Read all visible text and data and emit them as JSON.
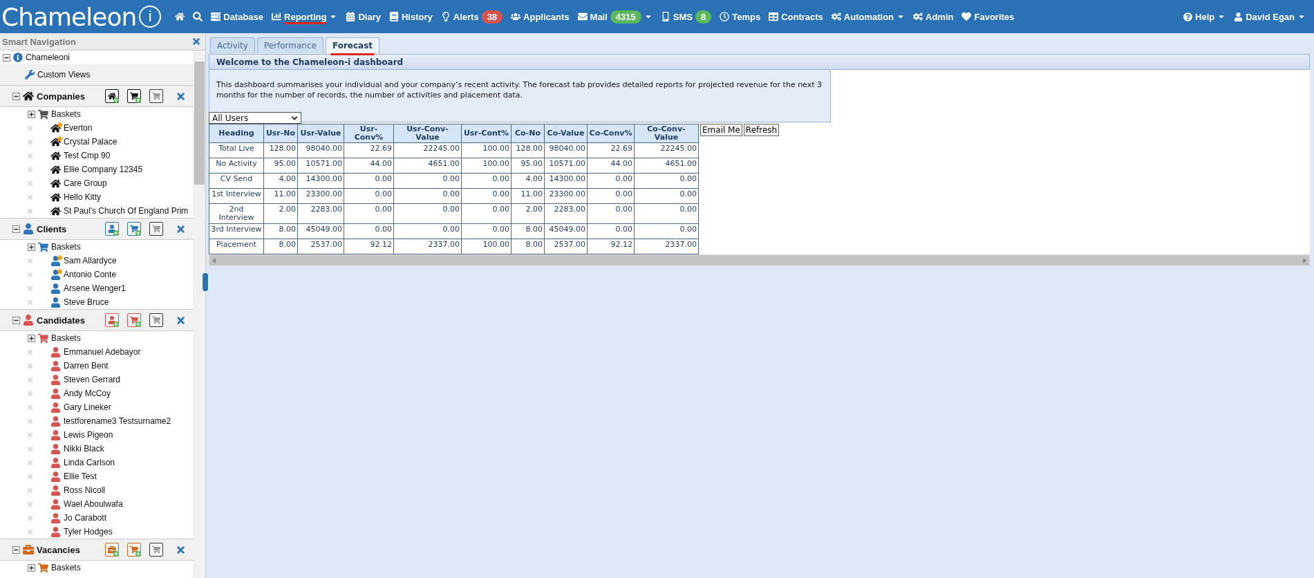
{
  "logo": {
    "text": "Chameleon",
    "mark": "i"
  },
  "nav": [
    {
      "kind": "home",
      "selected": false,
      "dropdown": false
    },
    {
      "kind": "search",
      "selected": false,
      "dropdown": false
    },
    {
      "kind": "database",
      "label": "Database",
      "selected": false,
      "dropdown": false
    },
    {
      "kind": "reporting",
      "label": "Reporting",
      "selected": true,
      "dropdown": true
    },
    {
      "kind": "diary",
      "label": "Diary",
      "selected": false,
      "dropdown": false
    },
    {
      "kind": "history",
      "label": "History",
      "selected": false,
      "dropdown": false
    },
    {
      "kind": "alerts",
      "label": "Alerts",
      "selected": false,
      "dropdown": false,
      "badge": "38",
      "color": "#d9534f"
    },
    {
      "kind": "applicants",
      "label": "Applicants",
      "selected": false,
      "dropdown": false
    },
    {
      "kind": "mail",
      "label": "Mail",
      "selected": false,
      "dropdown": true,
      "badge": "4315",
      "color": "#5cb85c"
    },
    {
      "kind": "sms",
      "label": "SMS",
      "selected": false,
      "dropdown": false,
      "badge": "8",
      "color": "#5cb85c"
    },
    {
      "kind": "temps",
      "label": "Temps",
      "selected": false,
      "dropdown": false
    },
    {
      "kind": "contracts",
      "label": "Contracts",
      "selected": false,
      "dropdown": false
    },
    {
      "kind": "automation",
      "label": "Automation",
      "selected": false,
      "dropdown": true
    },
    {
      "kind": "admin",
      "label": "Admin",
      "selected": false,
      "dropdown": false
    },
    {
      "kind": "favorites",
      "label": "Favorites",
      "selected": false,
      "dropdown": false
    }
  ],
  "nav_right": [
    {
      "kind": "help",
      "label": "Help",
      "dropdown": true
    },
    {
      "kind": "user",
      "label": "David Egan",
      "dropdown": true
    }
  ],
  "sidebar": {
    "title": "Smart Navigation",
    "root": {
      "label": "Chameleoni",
      "expanded": true
    },
    "custom_views": "Custom Views",
    "sections": [
      {
        "kind": "company",
        "title": "Companies",
        "color": "#111111",
        "expanded": true,
        "baskets": {
          "label": "Baskets",
          "expanded": false
        },
        "items": [
          {
            "label": "Everton",
            "starred": true
          },
          {
            "label": "Crystal Palace",
            "starred": true
          },
          {
            "label": "Test Cmp 90",
            "starred": false
          },
          {
            "label": "Ellie Company 12345",
            "starred": false
          },
          {
            "label": "Care Group",
            "starred": false
          },
          {
            "label": "Hello Kitty",
            "starred": false
          },
          {
            "label": "St Paul's Church Of England Prim",
            "starred": false
          }
        ]
      },
      {
        "kind": "client",
        "title": "Clients",
        "color": "#2a75bb",
        "expanded": true,
        "baskets": {
          "label": "Baskets",
          "expanded": false
        },
        "items": [
          {
            "label": "Sam Allardyce",
            "starred": true
          },
          {
            "label": "Antonio Conte",
            "starred": true
          },
          {
            "label": "Arsene Wenger1",
            "starred": false
          },
          {
            "label": "Steve Bruce",
            "starred": false
          }
        ]
      },
      {
        "kind": "candidate",
        "title": "Candidates",
        "color": "#d9534f",
        "expanded": true,
        "baskets": {
          "label": "Baskets",
          "expanded": false
        },
        "items": [
          {
            "label": "Emmanuel Adebayor",
            "starred": false
          },
          {
            "label": "Darren Bent",
            "starred": false
          },
          {
            "label": "Steven Gerrard",
            "starred": false
          },
          {
            "label": "Andy McCoy",
            "starred": false
          },
          {
            "label": "Gary Lineker",
            "starred": false
          },
          {
            "label": "testforename3 Testsurname2",
            "starred": false
          },
          {
            "label": "Lewis Pigeon",
            "starred": false
          },
          {
            "label": "Nikki Black",
            "starred": false
          },
          {
            "label": "Linda Carlson",
            "starred": false
          },
          {
            "label": "Ellie Test",
            "starred": false
          },
          {
            "label": "Ross Nicoll",
            "starred": false
          },
          {
            "label": "Wael Aboulwafa",
            "starred": false
          },
          {
            "label": "Jo Carabott",
            "starred": false
          },
          {
            "label": "Tyler Hodges",
            "starred": false
          }
        ]
      },
      {
        "kind": "vacancy",
        "title": "Vacancies",
        "color": "#d2691e",
        "expanded": true,
        "baskets": {
          "label": "Baskets",
          "expanded": false
        }
      }
    ]
  },
  "tabs": [
    {
      "label": "Activity",
      "selected": false
    },
    {
      "label": "Performance",
      "selected": false
    },
    {
      "label": "Forecast",
      "selected": true
    }
  ],
  "panel": {
    "title": "Welcome to the Chameleon-i dashboard",
    "description": "This dashboard summarises your individual and your company’s recent activity. The forecast tab provides detailed reports for projected revenue for the next 3 months for the number of records, the number of activities and placement data.",
    "filter": "All Users"
  },
  "table": {
    "columns": [
      "Heading",
      "Usr-No",
      "Usr-Value",
      "Usr-Conv%",
      "Usr-Conv-Value",
      "Usr-Cont%",
      "Co-No",
      "Co-Value",
      "Co-Conv%",
      "Co-Conv-Value"
    ],
    "rows": [
      [
        "Total Live",
        "128.00",
        "98040.00",
        "22.69",
        "22245.00",
        "100.00",
        "128.00",
        "98040.00",
        "22.69",
        "22245.00"
      ],
      [
        "No Activity",
        "95.00",
        "10571.00",
        "44.00",
        "4651.00",
        "100.00",
        "95.00",
        "10571.00",
        "44.00",
        "4651.00"
      ],
      [
        "CV Send",
        "4.00",
        "14300.00",
        "0.00",
        "0.00",
        "0.00",
        "4.00",
        "14300.00",
        "0.00",
        "0.00"
      ],
      [
        "1st Interview",
        "11.00",
        "23300.00",
        "0.00",
        "0.00",
        "0.00",
        "11.00",
        "23300.00",
        "0.00",
        "0.00"
      ],
      [
        "2nd Interview",
        "2.00",
        "2283.00",
        "0.00",
        "0.00",
        "0.00",
        "2.00",
        "2283.00",
        "0.00",
        "0.00"
      ],
      [
        "3rd Interview",
        "8.00",
        "45049.00",
        "0.00",
        "0.00",
        "0.00",
        "8.00",
        "45049.00",
        "0.00",
        "0.00"
      ],
      [
        "Placement",
        "8.00",
        "2537.00",
        "92.12",
        "2337.00",
        "100.00",
        "8.00",
        "2537.00",
        "92.12",
        "2337.00"
      ]
    ]
  },
  "buttons": [
    "Email Me",
    "Refresh"
  ]
}
